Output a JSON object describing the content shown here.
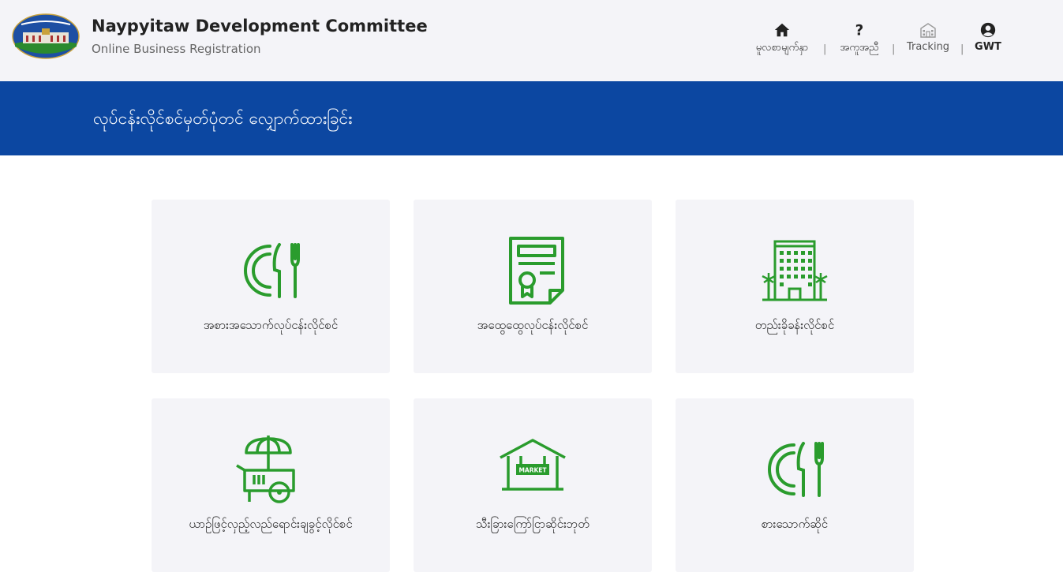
{
  "header": {
    "title": "Naypyitaw Development Committee",
    "subtitle": "Online Business Registration"
  },
  "nav": {
    "home_label": "မူလစာမျက်နှာ",
    "help_label": "အကူအညီ",
    "tracking_label": "Tracking",
    "user_label": "GWT",
    "separator": "|"
  },
  "banner": {
    "title": "လုပ်ငန်းလိုင်စင်မှတ်ပုံတင် လျှောက်ထားခြင်း"
  },
  "cards": [
    {
      "label": "အစားအသောက်လုပ်ငန်းလိုင်စင်",
      "icon": "dining-plate-icon"
    },
    {
      "label": "အထွေထွေလုပ်ငန်းလိုင်စင်",
      "icon": "certificate-document-icon"
    },
    {
      "label": "တည်းခိုခန်းလိုင်စင်",
      "icon": "hotel-building-icon"
    },
    {
      "label": "ယာဉ်ဖြင့်လှည့်လည်ရောင်းချခွင့်လိုင်စင်",
      "icon": "food-cart-icon"
    },
    {
      "label": "သီးခြားကြော်ငြာဆိုင်းဘုတ်",
      "icon": "market-stall-icon"
    },
    {
      "label": "စားသောက်ဆိုင်",
      "icon": "dining-plate-icon"
    }
  ],
  "market_sign_text": "MARKET",
  "colors": {
    "accent_green": "#2a9c2d",
    "banner_blue": "#0c47a1",
    "header_bg": "#f4f4f8"
  }
}
